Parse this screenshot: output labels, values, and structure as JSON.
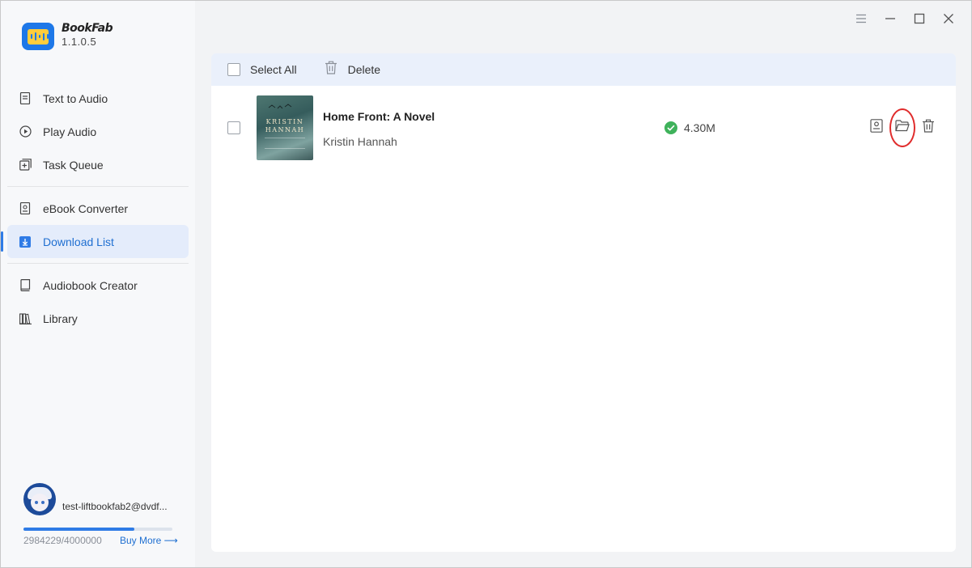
{
  "app": {
    "name": "BookFab",
    "version": "1.1.0.5",
    "brand_color": "#1e78e8",
    "accent_color": "#2f7be6"
  },
  "sidebar": {
    "groups": [
      [
        {
          "label": "Text to Audio",
          "icon": "document-icon"
        },
        {
          "label": "Play Audio",
          "icon": "play-circle-icon"
        },
        {
          "label": "Task Queue",
          "icon": "task-queue-icon"
        }
      ],
      [
        {
          "label": "eBook Converter",
          "icon": "ebook-icon"
        },
        {
          "label": "Download List",
          "icon": "download-icon",
          "active": true
        }
      ],
      [
        {
          "label": "Audiobook Creator",
          "icon": "audiobook-icon"
        },
        {
          "label": "Library",
          "icon": "library-icon"
        }
      ]
    ]
  },
  "account": {
    "email": "test-liftbookfab2@dvdf...",
    "quota_text": "2984229/4000000",
    "quota_used": 2984229,
    "quota_total": 4000000,
    "buy_more_label": "Buy More ⟶"
  },
  "window_controls": [
    "menu-icon",
    "minimize-icon",
    "maximize-icon",
    "close-icon"
  ],
  "toolbar": {
    "select_all_label": "Select All",
    "delete_label": "Delete"
  },
  "downloads": [
    {
      "title": "Home Front: A Novel",
      "author": "Kristin Hannah",
      "cover_text": "KRISTIN HANNAH",
      "status": "complete",
      "status_color": "#3fb25b",
      "size": "4.30M",
      "actions": [
        "ebook-details-icon",
        "open-folder-icon",
        "trash-icon"
      ],
      "highlighted_action": "open-folder-icon",
      "highlight_color": "#e02c2c"
    }
  ]
}
